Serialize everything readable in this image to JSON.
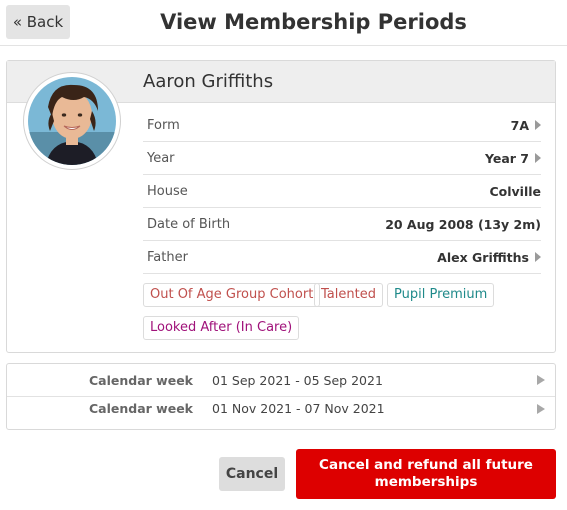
{
  "header": {
    "back_label": "« Back",
    "title": "View Membership Periods"
  },
  "student": {
    "name": "Aaron Griffiths",
    "details": [
      {
        "label": "Form",
        "value": "7A"
      },
      {
        "label": "Year",
        "value": "Year 7"
      },
      {
        "label": "House",
        "value": "Colville"
      },
      {
        "label": "Date of Birth",
        "value": "20 Aug 2008 (13y 2m)"
      },
      {
        "label": "Father",
        "value": "Alex Griffiths"
      }
    ],
    "tags": [
      {
        "label": "Out Of Age Group Cohort",
        "color": "#c0504d"
      },
      {
        "label": "Talented",
        "color": "#c0504d"
      },
      {
        "label": "Pupil Premium",
        "color": "#1f8a8a"
      },
      {
        "label": "Looked After (In Care)",
        "color": "#a0127a"
      }
    ]
  },
  "periods": [
    {
      "label": "Calendar week",
      "range": "01 Sep 2021 - 05 Sep 2021"
    },
    {
      "label": "Calendar week",
      "range": "01 Nov 2021 - 07 Nov 2021"
    }
  ],
  "actions": {
    "cancel_label": "Cancel",
    "refund_label": "Cancel and refund all future memberships"
  },
  "colors": {
    "danger": "#dd0000",
    "header_bg": "#eeeeee"
  }
}
